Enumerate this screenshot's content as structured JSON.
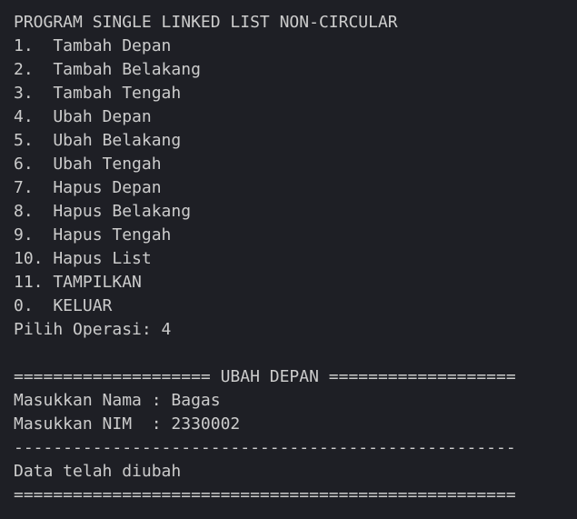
{
  "terminal": {
    "lines": [
      "PROGRAM SINGLE LINKED LIST NON-CIRCULAR",
      "1.  Tambah Depan",
      "2.  Tambah Belakang",
      "3.  Tambah Tengah",
      "4.  Ubah Depan",
      "5.  Ubah Belakang",
      "6.  Ubah Tengah",
      "7.  Hapus Depan",
      "8.  Hapus Belakang",
      "9.  Hapus Tengah",
      "10. Hapus List",
      "11. TAMPILKAN",
      "0.  KELUAR",
      "Pilih Operasi: 4",
      "",
      "==================== UBAH DEPAN ===================",
      "Masukkan Nama : Bagas",
      "Masukkan NIM  : 2330002",
      "---------------------------------------------------",
      "Data telah diubah",
      "==================================================="
    ]
  },
  "colors": {
    "background": "#1e1f25",
    "text": "#cccccc"
  }
}
